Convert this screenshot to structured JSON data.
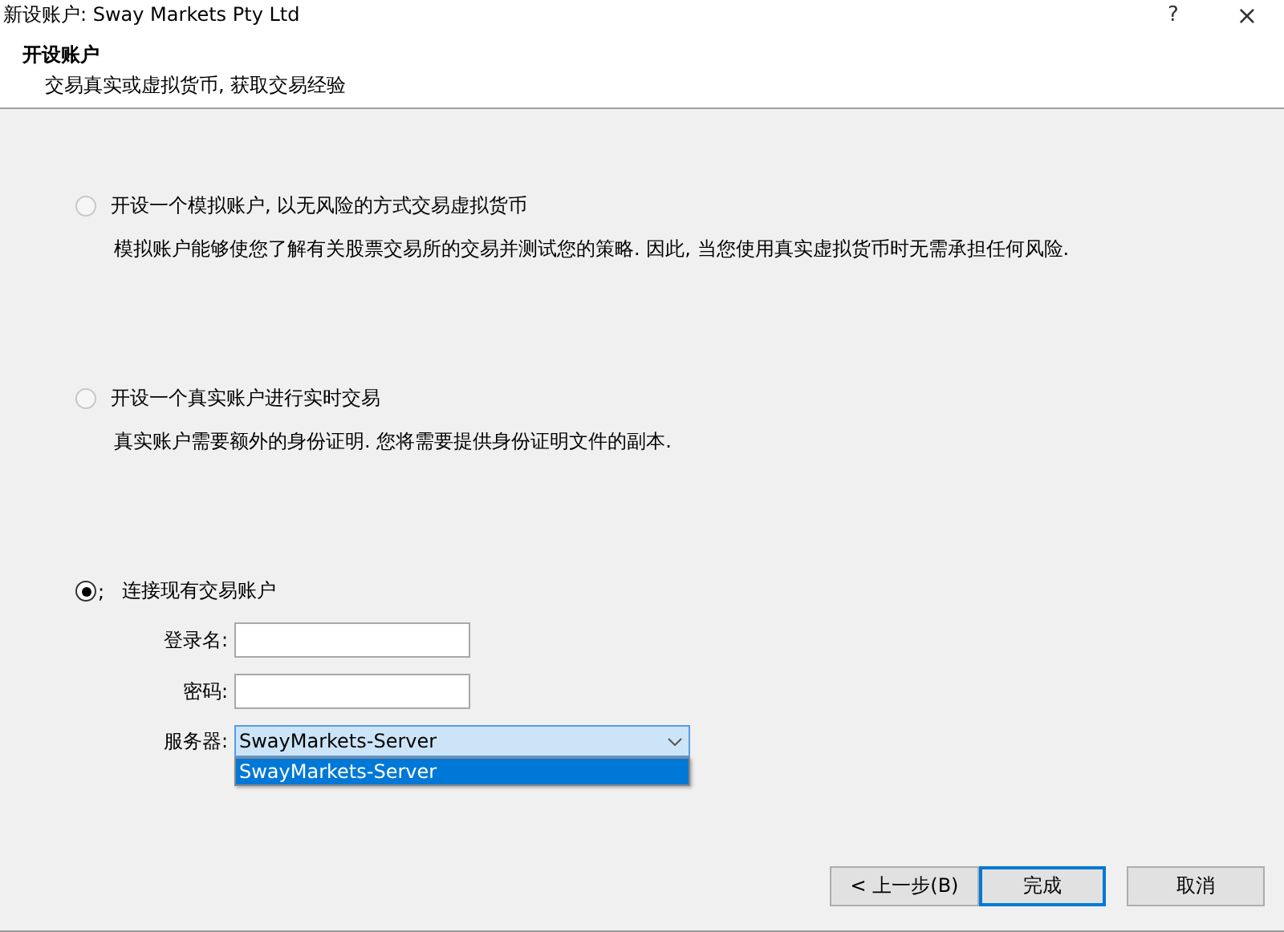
{
  "window": {
    "title": "新设账户: Sway Markets Pty Ltd",
    "help": "?",
    "close": "×"
  },
  "header": {
    "title": "开设账户",
    "subtitle": "交易真实或虚拟货币, 获取交易经验"
  },
  "options": [
    {
      "label": "开设一个模拟账户, 以无风险的方式交易虚拟货币",
      "description": "模拟账户能够使您了解有关股票交易所的交易并测试您的策略. 因此, 当您使用真实虚拟货币时无需承担任何风险.",
      "selected": false
    },
    {
      "label": "开设一个真实账户进行实时交易",
      "description": "真实账户需要额外的身份证明. 您将需要提供身份证明文件的副本.",
      "selected": false
    },
    {
      "label": "连接现有交易账户",
      "mark": ";",
      "selected": true
    }
  ],
  "form": {
    "login_label": "登录名:",
    "password_label": "密码:",
    "server_label": "服务器:",
    "server_value": "SwayMarkets-Server",
    "server_list": [
      {
        "label": "SwayMarkets-Server",
        "selected": true
      }
    ]
  },
  "buttons": [
    {
      "label": "< 上一步(B)",
      "default": false
    },
    {
      "label": "完成",
      "default": true
    },
    {
      "label": "取消",
      "default": false
    }
  ]
}
